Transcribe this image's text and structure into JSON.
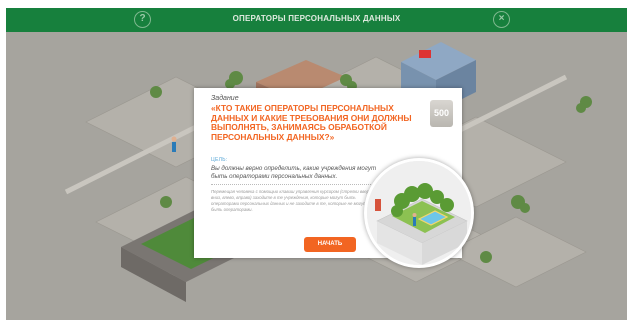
{
  "header": {
    "title": "ОПЕРАТОРЫ ПЕРСОНАЛЬНЫХ ДАННЫХ",
    "help_icon": "question-mark-icon",
    "close_icon": "close-x-icon",
    "help_glyph": "?",
    "close_glyph": "×"
  },
  "dialog": {
    "task_label": "Задание",
    "question": "«КТО ТАКИЕ ОПЕРАТОРЫ ПЕРСОНАЛЬНЫХ ДАННЫХ И КАКИЕ ТРЕБОВАНИЯ ОНИ ДОЛЖНЫ ВЫПОЛНЯТЬ, ЗАНИМАЯСЬ ОБРАБОТКОЙ ПЕРСОНАЛЬНЫХ ДАННЫХ?»",
    "points": "500",
    "goal_label": "ЦЕЛЬ:",
    "goal_text": "Вы должны верно определить, какие учреждения могут быть операторами персональных данных.",
    "instructions": "Перемещая человека с помощью клавиш управления курсором (стрелки вверх, вниз, влево, вправо) заходите в те учреждения, которые могут быть операторами персональных данных и не заходите в те, которые не могут быть операторами.",
    "start_button": "НАЧАТЬ"
  },
  "colors": {
    "header_green": "#17803d",
    "accent_orange": "#f26522",
    "goal_blue": "#57a6d6"
  }
}
